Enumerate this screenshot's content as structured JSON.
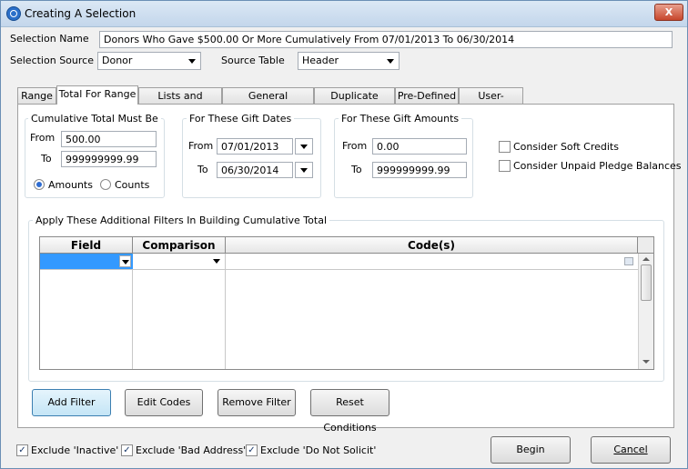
{
  "window": {
    "title": "Creating A Selection",
    "close_glyph": "X"
  },
  "selection_name": {
    "label": "Selection Name",
    "value": "Donors Who Gave $500.00 Or More Cumulatively From 07/01/2013 To 06/30/2014"
  },
  "selection_source": {
    "label": "Selection Source",
    "value": "Donor"
  },
  "source_table": {
    "label": "Source Table",
    "value": "Header"
  },
  "tabs": [
    {
      "label": "Range"
    },
    {
      "label": "Total For Range",
      "active": true
    },
    {
      "label": "Lists and Profiles"
    },
    {
      "label": "General Conditions"
    },
    {
      "label": "Duplicate Check"
    },
    {
      "label": "Pre-Defined"
    },
    {
      "label": "User-Defined"
    }
  ],
  "cumulative": {
    "title": "Cumulative Total Must Be",
    "from_label": "From",
    "from_value": "500.00",
    "to_label": "To",
    "to_value": "999999999.99",
    "amounts_label": "Amounts",
    "counts_label": "Counts",
    "selected": "Amounts"
  },
  "gift_dates": {
    "title": "For These Gift Dates",
    "from_label": "From",
    "from_value": "07/01/2013",
    "to_label": "To",
    "to_value": "06/30/2014"
  },
  "gift_amounts": {
    "title": "For These Gift Amounts",
    "from_label": "From",
    "from_value": "0.00",
    "to_label": "To",
    "to_value": "999999999.99"
  },
  "options": {
    "soft_credits": "Consider Soft Credits",
    "soft_credits_checked": false,
    "unpaid_pledge": "Consider Unpaid Pledge Balances",
    "unpaid_pledge_checked": false
  },
  "filters": {
    "title": "Apply These Additional Filters In Building Cumulative Total",
    "columns": [
      "Field",
      "Comparison",
      "Code(s)"
    ]
  },
  "buttons": {
    "add_filter": "Add Filter",
    "edit_codes": "Edit Codes",
    "remove_filter": "Remove Filter",
    "reset_conditions": "Reset Conditions",
    "begin": "Begin",
    "cancel": "Cancel"
  },
  "excludes": [
    {
      "label": "Exclude 'Inactive'",
      "checked": true
    },
    {
      "label": "Exclude 'Bad Address'",
      "checked": true
    },
    {
      "label": "Exclude 'Do Not Solicit'",
      "checked": true
    }
  ],
  "colors": {
    "accent": "#2f6cd1",
    "grid_selected_cell": "#3399ff"
  }
}
